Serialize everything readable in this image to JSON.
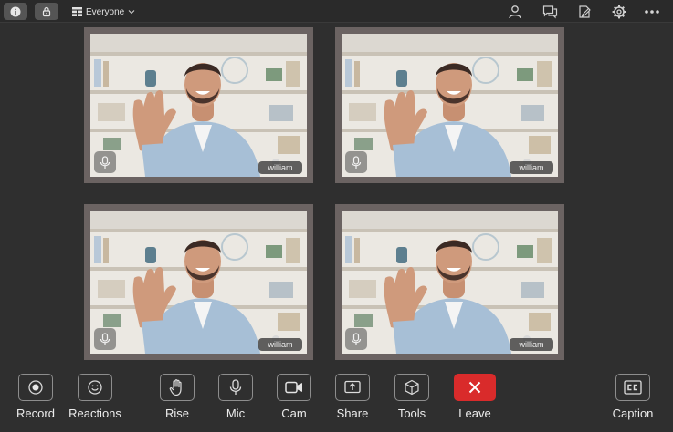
{
  "header": {
    "audience_label": "Everyone",
    "left_icons": [
      "info-icon",
      "lock-icon",
      "grid-icon"
    ],
    "right_icons": [
      "person-icon",
      "chat-icon",
      "notes-icon",
      "gear-icon",
      "more-icon"
    ]
  },
  "participants": [
    {
      "name": "william"
    },
    {
      "name": "william"
    },
    {
      "name": "william"
    },
    {
      "name": "william"
    }
  ],
  "toolbar": {
    "record_label": "Record",
    "reactions_label": "Reactions",
    "rise_label": "Rise",
    "mic_label": "Mic",
    "cam_label": "Cam",
    "share_label": "Share",
    "tools_label": "Tools",
    "leave_label": "Leave",
    "caption_label": "Caption"
  },
  "colors": {
    "background": "#2f2f2f",
    "tile_frame": "#6b6362",
    "leave_red": "#d92b2b",
    "icon_gray": "#8d8d8d"
  }
}
